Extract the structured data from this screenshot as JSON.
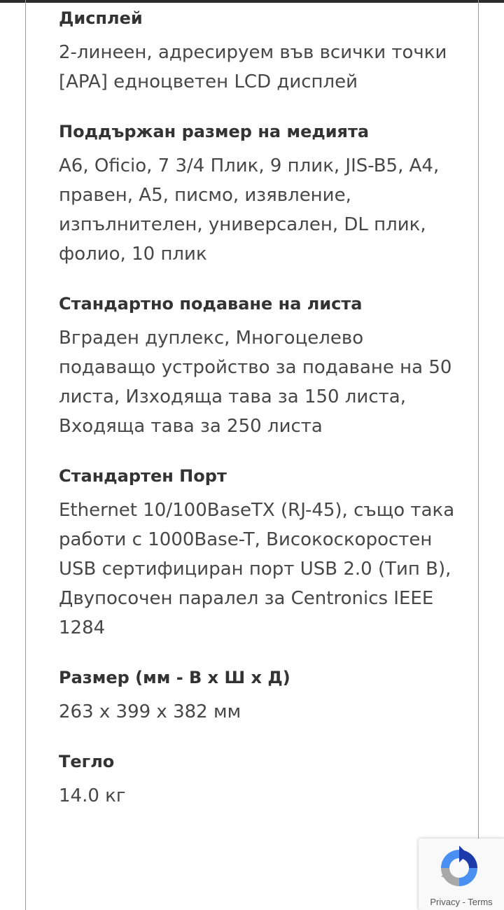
{
  "specs": [
    {
      "title": "Дисплей",
      "value": "2-линеен, адресируем във всички точки [APA] едноцветен LCD дисплей"
    },
    {
      "title": "Поддържан размер на медията",
      "value": "A6, Oficio, 7 3/4 Плик, 9 плик, JIS-B5, A4, правен, A5, писмо, изявление, изпълнителен, универсален, DL плик, фолио, 10 плик"
    },
    {
      "title": "Стандартно подаване на листа",
      "value": "Вграден дуплекс, Многоцелево подаващо устройство за подаване на 50 листа, Изходяща тава за 150 листа, Входяща тава за 250 листа"
    },
    {
      "title": "Стандартен Порт",
      "value": "Ethernet 10/100BaseTX (RJ-45), също така работи с 1000Base-T, Високоскоростен USB сертифициран порт USB 2.0 (Тип B), Двупосочен паралел за Centronics IEEE 1284"
    },
    {
      "title": "Размер (мм - В x Ш x Д)",
      "value": "263 x 399 x 382 мм"
    },
    {
      "title": "Тегло",
      "value": "14.0 кг"
    }
  ],
  "recaptcha": {
    "privacy_label": "Privacy",
    "separator": " - ",
    "terms_label": "Terms",
    "icon": "recaptcha-icon"
  }
}
